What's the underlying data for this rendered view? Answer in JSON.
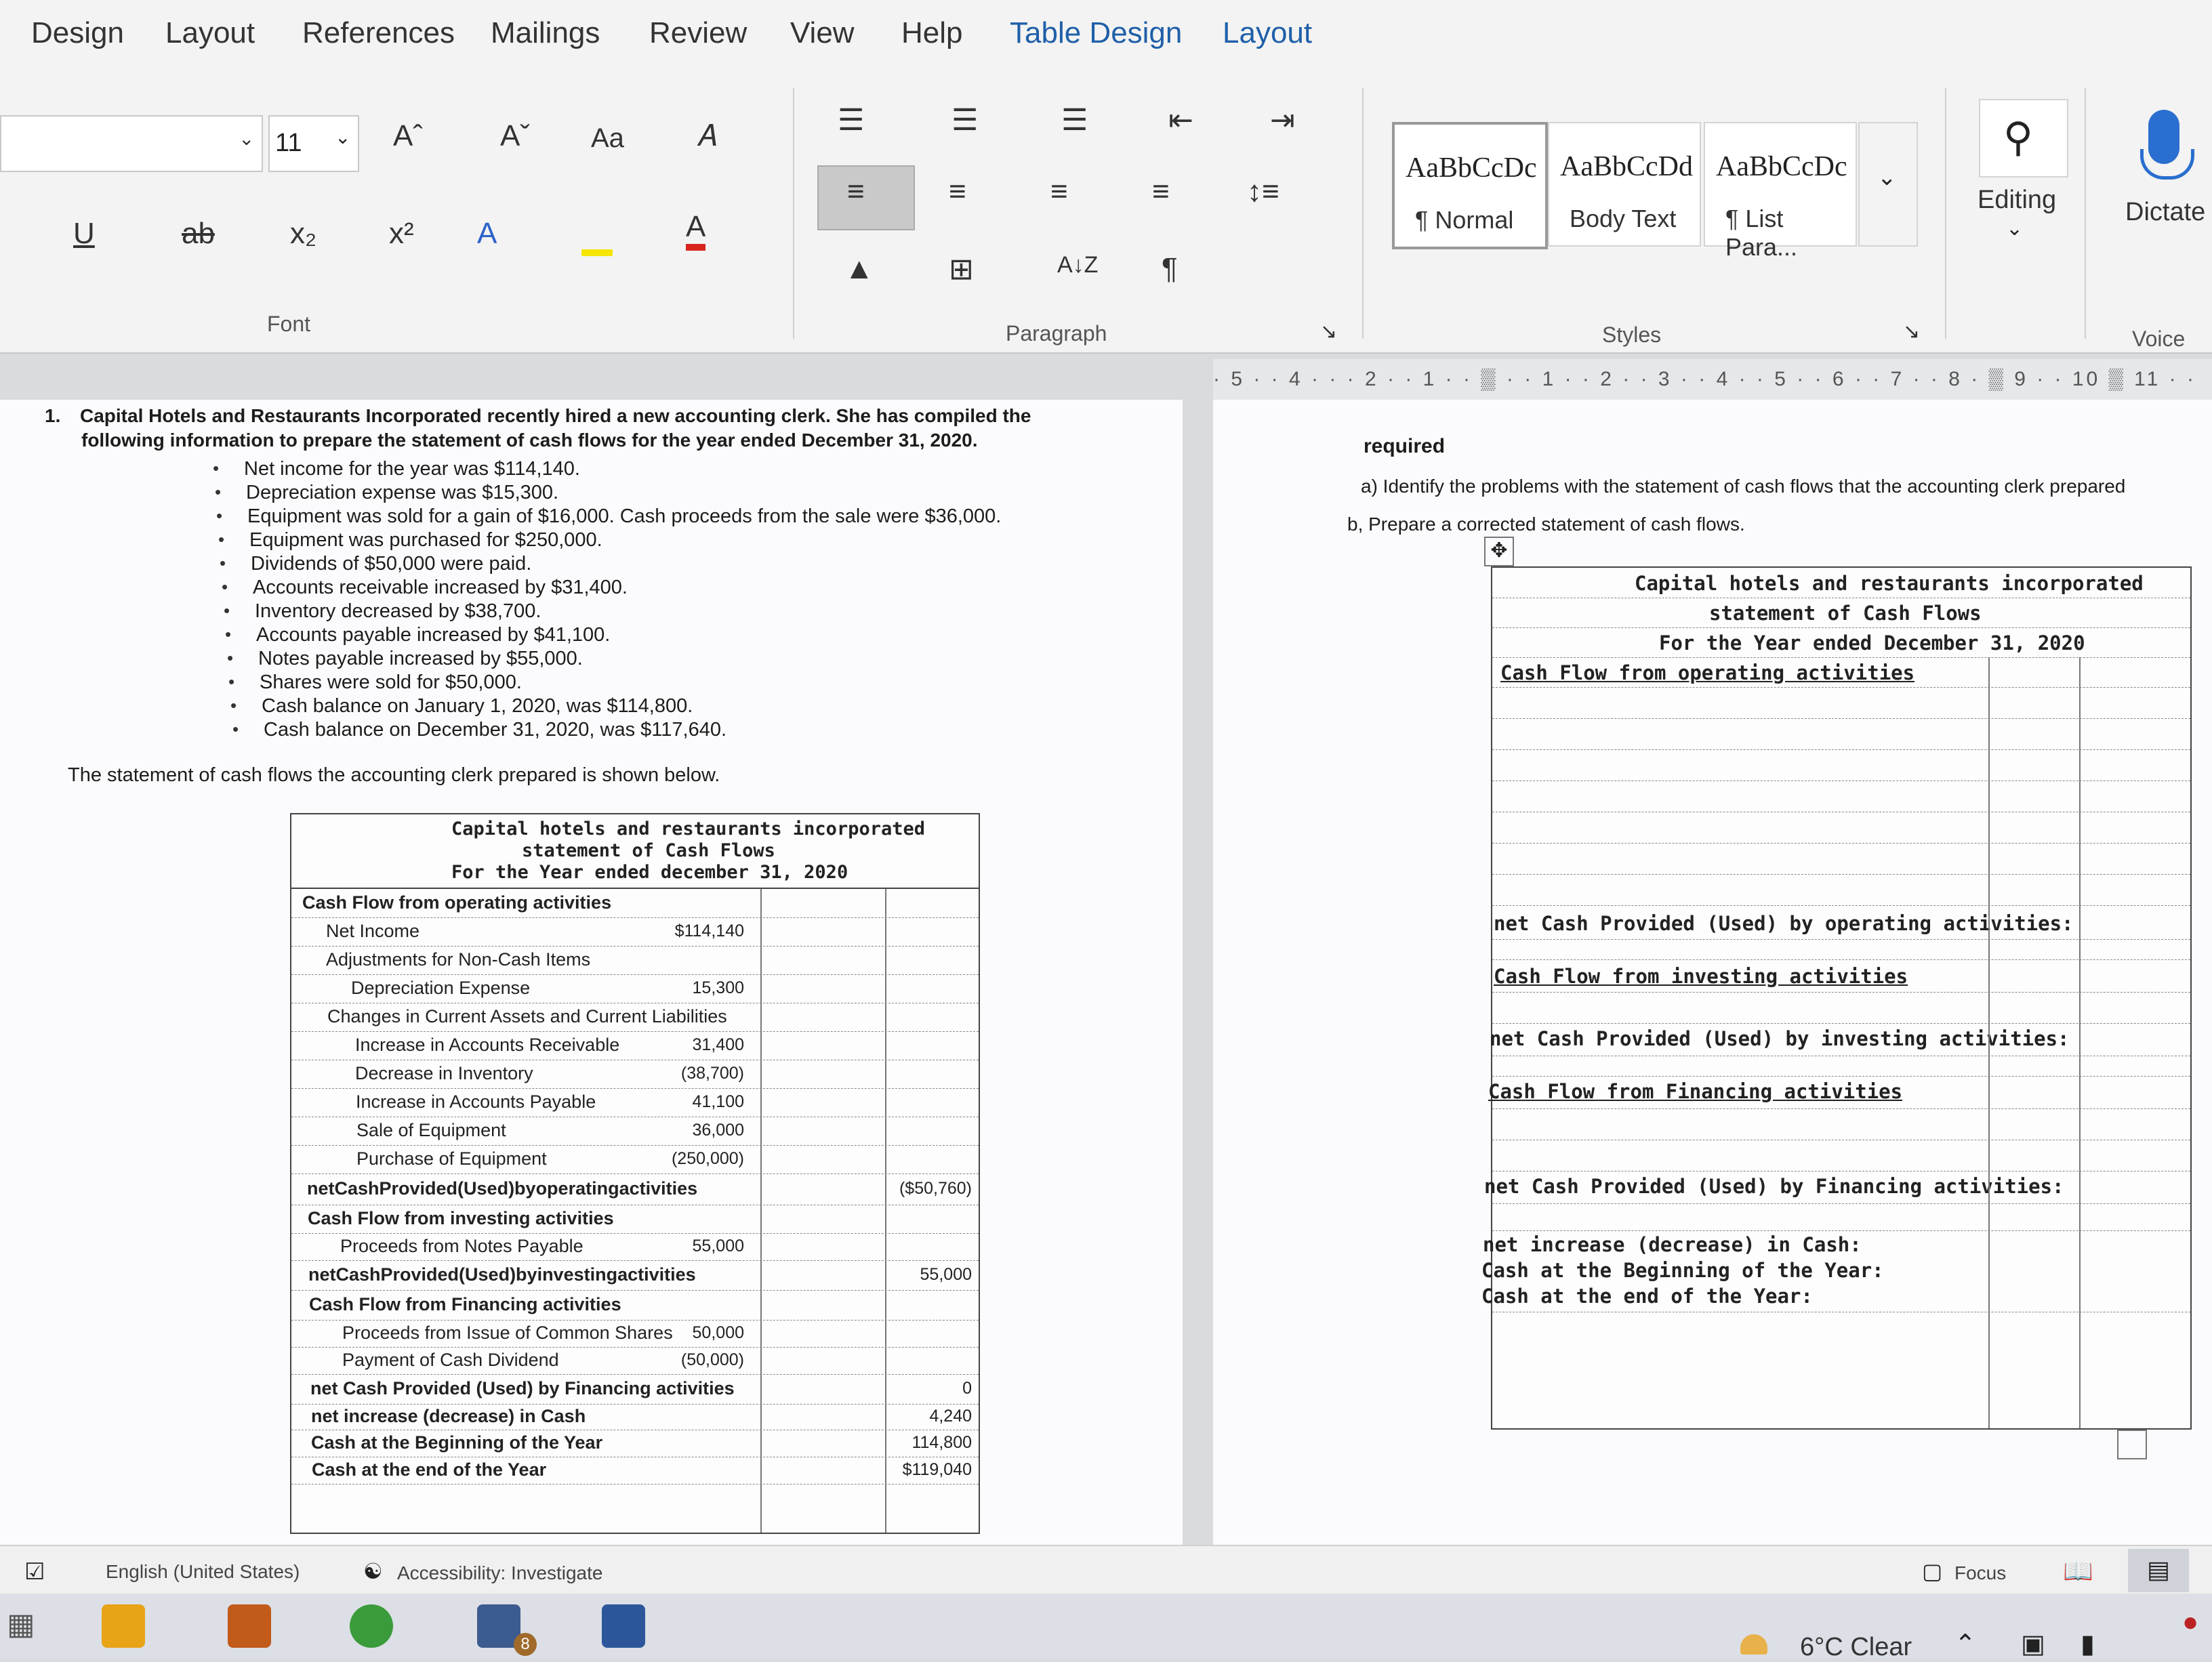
{
  "tabs": [
    "Design",
    "Layout",
    "References",
    "Mailings",
    "Review",
    "View",
    "Help",
    "Table Design",
    "Layout"
  ],
  "font_group": {
    "size": "11",
    "label": "Font",
    "grow": "Aˆ",
    "shrink": "Aˇ",
    "case": "Aa",
    "sub": "x₂",
    "sup": "x²"
  },
  "paragraph_group": {
    "label": "Paragraph",
    "sort": "A↓Z",
    "pilcrow": "¶"
  },
  "styles_group": {
    "label": "Styles",
    "items": [
      {
        "preview": "AaBbCcDc",
        "name": "¶ Normal"
      },
      {
        "preview": "AaBbCcDd",
        "name": "Body Text"
      },
      {
        "preview": "AaBbCcDc",
        "name": "¶ List Para..."
      }
    ]
  },
  "editing": {
    "label": "Editing"
  },
  "voice": {
    "dictate": "Dictate",
    "label": "Voice"
  },
  "ruler": "· 5 · · 4 · ·   · 2 · · 1 · · ▒ · · 1 · · 2 · · 3 · · 4 · · 5 · · 6 · · 7 · · 8 · ▒ 9 · · 10 ▒ 11 · · 1",
  "question": {
    "number": "1.",
    "line1": "Capital Hotels and Restaurants Incorporated recently hired a new accounting clerk. She has compiled the",
    "line2": "following information to prepare the statement of cash flows for the year ended December 31, 2020.",
    "bullets": [
      "Net income for the year was $114,140.",
      "Depreciation expense was $15,300.",
      "Equipment was sold for a gain of $16,000. Cash proceeds from the sale were $36,000.",
      "Equipment was purchased for $250,000.",
      "Dividends of $50,000 were paid.",
      "Accounts receivable increased by $31,400.",
      "Inventory decreased by $38,700.",
      "Accounts payable increased by $41,100.",
      "Notes payable increased by $55,000.",
      "Shares were sold for $50,000.",
      "Cash balance on January 1, 2020, was $114,800.",
      "Cash balance on December 31, 2020, was $117,640."
    ],
    "intro": "The statement of cash flows the accounting clerk prepared is shown below."
  },
  "clerk_statement": {
    "title1": "Capital hotels and restaurants incorporated",
    "title2": "statement of Cash Flows",
    "title3": "For the Year ended december 31, 2020",
    "rows": [
      {
        "label": "Cash Flow from operating activities",
        "a": "",
        "b": ""
      },
      {
        "label": "Net Income",
        "a": "$114,140",
        "b": ""
      },
      {
        "label": "Adjustments for Non-Cash Items",
        "a": "",
        "b": ""
      },
      {
        "label": "Depreciation Expense",
        "a": "15,300",
        "b": ""
      },
      {
        "label": "Changes in Current Assets and Current Liabilities",
        "a": "",
        "b": ""
      },
      {
        "label": "Increase in Accounts Receivable",
        "a": "31,400",
        "b": ""
      },
      {
        "label": "Decrease in Inventory",
        "a": "(38,700)",
        "b": ""
      },
      {
        "label": "Increase in Accounts Payable",
        "a": "41,100",
        "b": ""
      },
      {
        "label": "Sale of Equipment",
        "a": "36,000",
        "b": ""
      },
      {
        "label": "Purchase of Equipment",
        "a": "(250,000)",
        "b": ""
      },
      {
        "label": "netCashProvided(Used)byoperatingactivities",
        "a": "",
        "b": "($50,760)"
      },
      {
        "label": "Cash Flow from investing activities",
        "a": "",
        "b": ""
      },
      {
        "label": "Proceeds from Notes Payable",
        "a": "55,000",
        "b": ""
      },
      {
        "label": "netCashProvided(Used)byinvestingactivities",
        "a": "",
        "b": "55,000"
      },
      {
        "label": "Cash Flow from Financing activities",
        "a": "",
        "b": ""
      },
      {
        "label": "Proceeds from Issue of Common Shares",
        "a": "50,000",
        "b": ""
      },
      {
        "label": "Payment of Cash Dividend",
        "a": "(50,000)",
        "b": ""
      },
      {
        "label": "net Cash Provided (Used) by Financing activities",
        "a": "",
        "b": "0"
      },
      {
        "label": "net increase (decrease) in Cash",
        "a": "",
        "b": "4,240"
      },
      {
        "label": "Cash at the Beginning of the Year",
        "a": "",
        "b": "114,800"
      },
      {
        "label": "Cash at the end of the Year",
        "a": "",
        "b": "$119,040"
      }
    ]
  },
  "required": {
    "heading": "required",
    "a": "a)   Identify the problems with the statement of cash flows that the accounting clerk prepared",
    "b": "b, Prepare a corrected statement of cash flows."
  },
  "corrected_statement": {
    "title1": "Capital hotels and restaurants incorporated",
    "title2": "statement of Cash Flows",
    "title3": "For the Year ended December 31, 2020",
    "operating": "Cash Flow from operating activities",
    "net_operating": "net Cash Provided (Used) by operating activities:",
    "investing": "Cash Flow from investing activities",
    "net_investing": "net Cash Provided (Used) by investing activities:",
    "financing": "Cash Flow from Financing activities",
    "net_financing": "net Cash Provided (Used) by Financing activities:",
    "net_increase": "net increase (decrease) in Cash:",
    "cash_begin": "Cash at the Beginning of the Year:",
    "cash_end": "Cash at the end of the Year:"
  },
  "status": {
    "language": "English (United States)",
    "accessibility": "Accessibility: Investigate",
    "focus": "Focus"
  },
  "taskbar": {
    "weather": "6°C  Clear",
    "mail_badge": "8"
  }
}
